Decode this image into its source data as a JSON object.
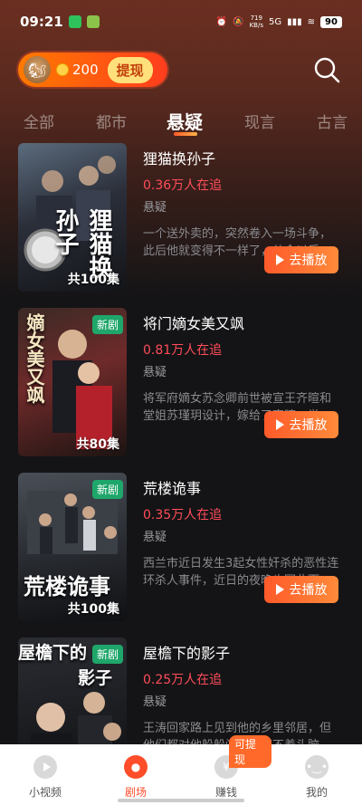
{
  "status_bar": {
    "time": "09:21",
    "net_speed": "719",
    "net_unit": "KB/s",
    "signal": "5G",
    "battery": "90"
  },
  "wallet": {
    "coins": "200",
    "withdraw_label": "提现"
  },
  "tabs": [
    {
      "label": "全部"
    },
    {
      "label": "都市"
    },
    {
      "label": "悬疑"
    },
    {
      "label": "现言"
    },
    {
      "label": "古言"
    }
  ],
  "dramas": [
    {
      "title": "狸猫换孙子",
      "followers": "0.36万人在追",
      "genre": "悬疑",
      "description": "一个送外卖的，突然卷入一场斗争，此后他就变得不一样了，从今以后…",
      "episodes": "共100集",
      "badge": "",
      "poster_title": "狸猫换孙子",
      "play_label": "去播放"
    },
    {
      "title": "将门嫡女美又飒",
      "followers": "0.81万人在追",
      "genre": "悬疑",
      "description": "将军府嫡女苏念卿前世被宣王齐暄和堂姐苏瑾玥设计，嫁给了齐暄，举…",
      "episodes": "共80集",
      "badge": "新剧",
      "poster_title": "嫡女美又飒",
      "play_label": "去播放"
    },
    {
      "title": "荒楼诡事",
      "followers": "0.35万人在追",
      "genre": "悬疑",
      "description": "西兰市近日发生3起女性奸杀的恶性连环杀人事件，近日的夜晚也因此而…",
      "episodes": "共100集",
      "badge": "新剧",
      "poster_title": "荒楼诡事",
      "play_label": "去播放"
    },
    {
      "title": "屋檐下的影子",
      "followers": "0.25万人在追",
      "genre": "悬疑",
      "description": "王涛回家路上见到他的乡里邻居，但他们都对他躲躲闪闪，摸不着头脑…",
      "episodes": "",
      "badge": "新剧",
      "poster_title": "屋檐下的影子",
      "play_label": "去播放"
    }
  ],
  "bottom_nav": [
    {
      "label": "小视频",
      "icon": "play-circle-icon"
    },
    {
      "label": "剧场",
      "icon": "theater-icon"
    },
    {
      "label": "赚钱",
      "icon": "money-bag-icon",
      "pill": "可提现"
    },
    {
      "label": "我的",
      "icon": "profile-icon"
    }
  ],
  "colors": {
    "accent": "#ff4d2a",
    "followers": "#ff4d5a",
    "badge": "#1fa66a"
  }
}
